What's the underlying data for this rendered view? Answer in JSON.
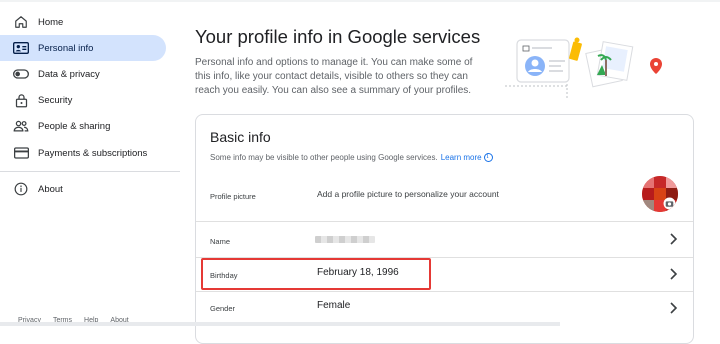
{
  "sidebar": {
    "items": [
      {
        "label": "Home",
        "icon": "home-icon"
      },
      {
        "label": "Personal info",
        "icon": "id-card-icon",
        "active": true
      },
      {
        "label": "Data & privacy",
        "icon": "toggle-icon"
      },
      {
        "label": "Security",
        "icon": "lock-icon"
      },
      {
        "label": "People & sharing",
        "icon": "people-icon"
      },
      {
        "label": "Payments & subscriptions",
        "icon": "credit-card-icon"
      },
      {
        "label": "About",
        "icon": "info-icon"
      }
    ],
    "footer": [
      "Privacy",
      "Terms",
      "Help",
      "About"
    ]
  },
  "header": {
    "title": "Your profile info in Google services",
    "description": "Personal info and options to manage it. You can make some of this info, like your contact details, visible to others so they can reach you easily. You can also see a summary of your profiles."
  },
  "basic_info": {
    "title": "Basic info",
    "subtitle": "Some info may be visible to other people using Google services.",
    "learn_more": "Learn more",
    "rows": {
      "photo": {
        "label": "Profile picture",
        "value": "Add a profile picture to personalize your account"
      },
      "name": {
        "label": "Name",
        "value": ""
      },
      "birthday": {
        "label": "Birthday",
        "value": "February 18, 1996"
      },
      "gender": {
        "label": "Gender",
        "value": "Female"
      }
    }
  },
  "colors": {
    "active_nav": "#d3e3fd",
    "link": "#1a73e8",
    "highlight_box": "#e53935"
  }
}
